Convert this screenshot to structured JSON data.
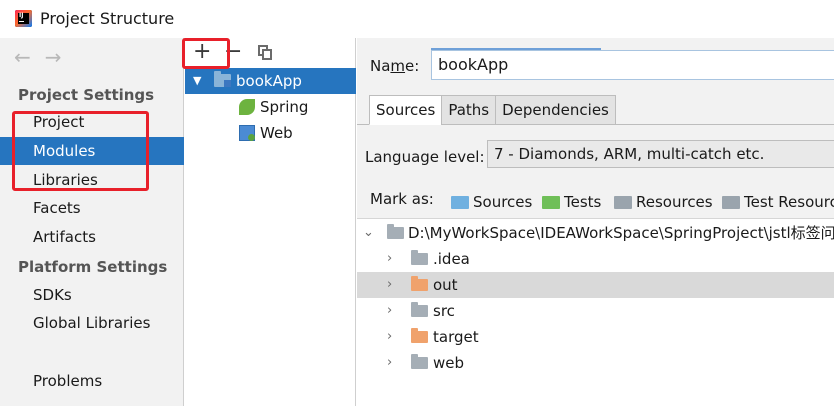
{
  "window": {
    "title": "Project Structure",
    "icon": "intellij-idea-icon"
  },
  "nav": {
    "back_icon": "←",
    "forward_icon": "→"
  },
  "sidebar": {
    "section1": "Project Settings",
    "items1": [
      {
        "label": "Project",
        "selected": false
      },
      {
        "label": "Modules",
        "selected": true
      },
      {
        "label": "Libraries",
        "selected": false
      },
      {
        "label": "Facets",
        "selected": false
      },
      {
        "label": "Artifacts",
        "selected": false
      }
    ],
    "section2": "Platform Settings",
    "items2": [
      {
        "label": "SDKs"
      },
      {
        "label": "Global Libraries"
      }
    ],
    "problems": "Problems"
  },
  "module_tree": {
    "toolbar": {
      "add": "+",
      "remove": "−"
    },
    "root": {
      "label": "bookApp",
      "expanded": true
    },
    "children": [
      {
        "label": "Spring",
        "icon": "spring-icon"
      },
      {
        "label": "Web",
        "icon": "web-icon"
      }
    ]
  },
  "details": {
    "name_label_prefix": "Na",
    "name_label_mnemonic": "m",
    "name_label_suffix": "e:",
    "name_value": "bookApp",
    "tabs": [
      {
        "label": "Sources",
        "active": true
      },
      {
        "label": "Paths",
        "active": false
      },
      {
        "label": "Dependencies",
        "active": false
      }
    ],
    "language_level_label": "Language level:",
    "language_level_value": "7 - Diamonds, ARM, multi-catch etc.",
    "mark_as_label": "Mark as:",
    "mark_as": [
      {
        "label": "Sources",
        "color": "#6fb0e0"
      },
      {
        "label": "Tests",
        "color": "#6fbf58"
      },
      {
        "label": "Resources",
        "color": "#9aa4ad"
      },
      {
        "label": "Test Resources",
        "color": "#9aa4ad"
      }
    ],
    "content_root": "D:\\MyWorkSpace\\IDEAWorkSpace\\SpringProject\\jstl标签问",
    "folders": [
      {
        "label": ".idea",
        "color": "#a5aeb6",
        "highlighted": false
      },
      {
        "label": "out",
        "color": "#f0a26c",
        "highlighted": true
      },
      {
        "label": "src",
        "color": "#a5aeb6",
        "highlighted": false
      },
      {
        "label": "target",
        "color": "#f0a26c",
        "highlighted": false
      },
      {
        "label": "web",
        "color": "#a5aeb6",
        "highlighted": false
      }
    ]
  },
  "colors": {
    "selection": "#2675bf",
    "annotation": "#e8202a"
  }
}
